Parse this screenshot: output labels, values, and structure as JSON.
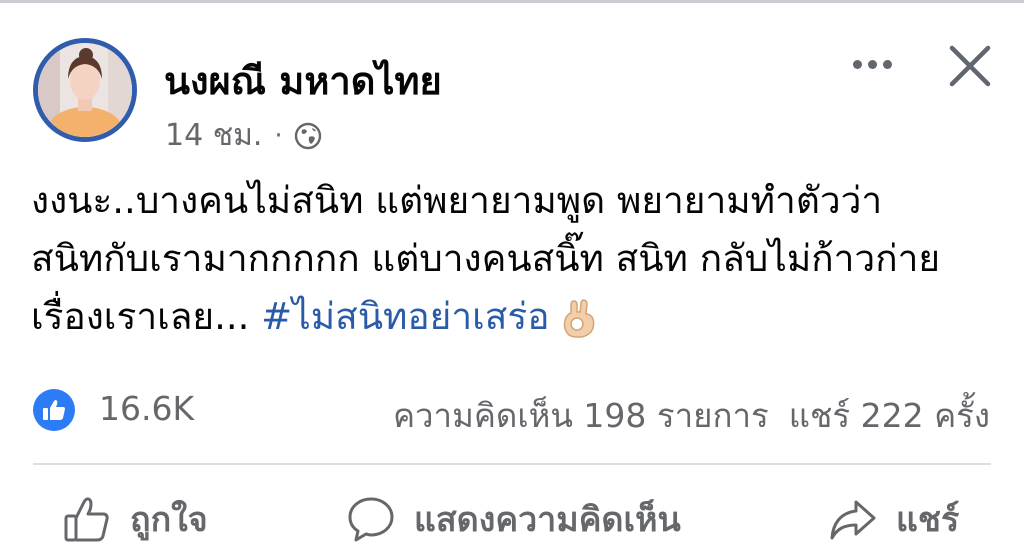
{
  "post": {
    "author_name": "นงผณี มหาดไทย",
    "time_ago": "14 ชม.",
    "separator": "·",
    "privacy_icon": "globe-icon",
    "text_lines": [
      "งงนะ..บางคนไม่สนิท แต่พยายามพูด พยายามทำตัวว่า",
      "สนิทกับเรามากกกกก แต่บางคนสนิ๊ท สนิท กลับไม่ก้าวก่าย",
      "เรื่องเราเลย..."
    ],
    "hashtag": "#ไม่สนิทอย่าเสร่อ",
    "emoji_icon": "ok-hand-icon"
  },
  "stats": {
    "reaction_icon": "like-icon",
    "likes": "16.6K",
    "comments": "ความคิดเห็น 198 รายการ",
    "shares": "แชร์ 222 ครั้ง"
  },
  "actions": {
    "like_label": "ถูกใจ",
    "comment_label": "แสดงความคิดเห็น",
    "share_label": "แชร์"
  },
  "colors": {
    "hashtag": "#2a5ba8",
    "like_badge": "#2d7cf6",
    "avatar_ring": "#2f5cab",
    "secondary_text": "#65676b"
  }
}
